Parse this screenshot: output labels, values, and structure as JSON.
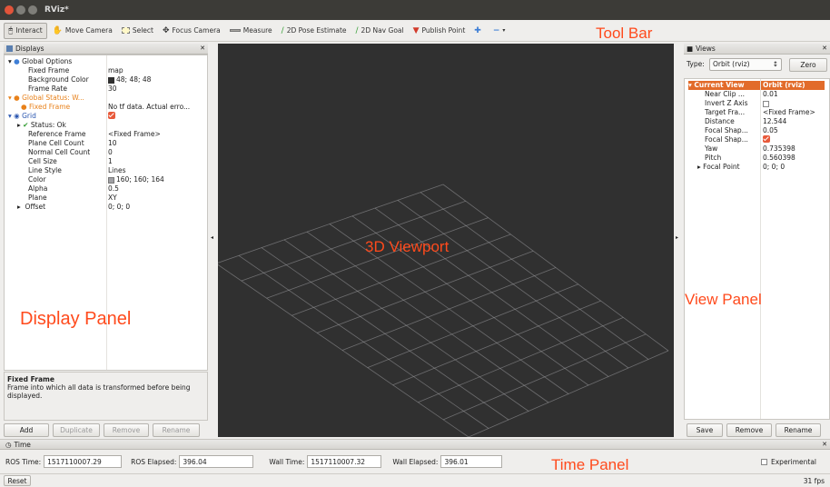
{
  "window": {
    "title": "RViz*"
  },
  "toolbar": {
    "tools": [
      {
        "label": "Interact",
        "icon": "cursor-icon"
      },
      {
        "label": "Move Camera",
        "icon": "move-hand-icon"
      },
      {
        "label": "Select",
        "icon": "select-rect-icon"
      },
      {
        "label": "Focus Camera",
        "icon": "focus-icon"
      },
      {
        "label": "Measure",
        "icon": "ruler-icon"
      },
      {
        "label": "2D Pose Estimate",
        "icon": "green-arrow-icon"
      },
      {
        "label": "2D Nav Goal",
        "icon": "green-arrow-icon"
      },
      {
        "label": "Publish Point",
        "icon": "map-pin-icon"
      }
    ]
  },
  "displays": {
    "title": "Displays",
    "global_options": "Global Options",
    "fixed_frame_label": "Fixed Frame",
    "fixed_frame_value": "map",
    "bg_color_label": "Background Color",
    "bg_color_value": "48; 48; 48",
    "frame_rate_label": "Frame Rate",
    "frame_rate_value": "30",
    "global_status": "Global Status: W...",
    "status_fixed_frame": "Fixed Frame",
    "status_fixed_frame_value": "No tf data.  Actual erro...",
    "grid": "Grid",
    "grid_status": "Status: Ok",
    "ref_frame_label": "Reference Frame",
    "ref_frame_value": "<Fixed Frame>",
    "plane_count_label": "Plane Cell Count",
    "plane_count_value": "10",
    "normal_count_label": "Normal Cell Count",
    "normal_count_value": "0",
    "cell_size_label": "Cell Size",
    "cell_size_value": "1",
    "line_style_label": "Line Style",
    "line_style_value": "Lines",
    "color_label": "Color",
    "color_value": "160; 160; 164",
    "alpha_label": "Alpha",
    "alpha_value": "0.5",
    "plane_label": "Plane",
    "plane_value": "XY",
    "offset_label": "Offset",
    "offset_value": "0; 0; 0",
    "desc_title": "Fixed Frame",
    "desc_text": "Frame into which all data is transformed before being displayed.",
    "buttons": {
      "add": "Add",
      "duplicate": "Duplicate",
      "remove": "Remove",
      "rename": "Rename"
    }
  },
  "views": {
    "title": "Views",
    "type_label": "Type:",
    "type_value": "Orbit (rviz)",
    "zero": "Zero",
    "current_view": "Current View",
    "current_view_value": "Orbit (rviz)",
    "near_clip": "Near Clip ...",
    "near_clip_value": "0.01",
    "invert_z": "Invert Z Axis",
    "target_frame": "Target Fra...",
    "target_frame_value": "<Fixed Frame>",
    "distance": "Distance",
    "distance_value": "12.544",
    "focal_shape1": "Focal Shap...",
    "focal_shape1_value": "0.05",
    "focal_shape2": "Focal Shap...",
    "yaw": "Yaw",
    "yaw_value": "0.735398",
    "pitch": "Pitch",
    "pitch_value": "0.560398",
    "focal_point": "Focal Point",
    "focal_point_value": "0; 0; 0",
    "buttons": {
      "save": "Save",
      "remove": "Remove",
      "rename": "Rename"
    }
  },
  "time": {
    "title": "Time",
    "ros_time_label": "ROS Time:",
    "ros_time_value": "1517110007.29",
    "ros_elapsed_label": "ROS Elapsed:",
    "ros_elapsed_value": "396.04",
    "wall_time_label": "Wall Time:",
    "wall_time_value": "1517110007.32",
    "wall_elapsed_label": "Wall Elapsed:",
    "wall_elapsed_value": "396.01",
    "experimental": "Experimental"
  },
  "status": {
    "reset": "Reset",
    "fps": "31 fps"
  },
  "annotations": {
    "toolbar": "Tool Bar",
    "viewport": "3D Viewport",
    "display_panel": "Display Panel",
    "view_panel": "View Panel",
    "time_panel": "Time Panel"
  },
  "colors": {
    "annotation": "#ff4a1c",
    "viewport_bg": "#303030",
    "grid": "#a0a0a4"
  }
}
